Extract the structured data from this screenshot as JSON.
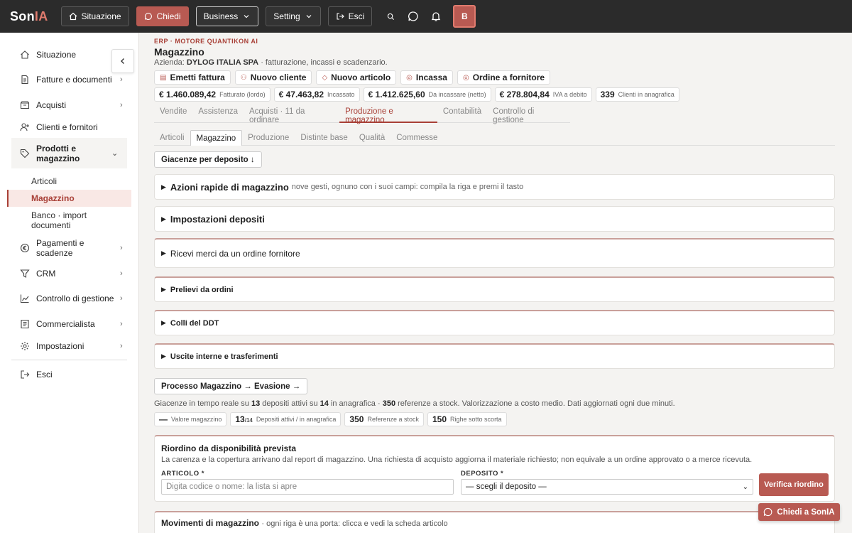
{
  "topbar": {
    "logo_a": "Son",
    "logo_b": "IA",
    "situazione": "Situazione",
    "chiedi": "Chiedi",
    "business": "Business",
    "setting": "Setting",
    "esci": "Esci",
    "avatar": "B"
  },
  "sidebar": {
    "situazione": "Situazione",
    "fatture": "Fatture e documenti",
    "acquisti": "Acquisti",
    "clienti": "Clienti e fornitori",
    "prodotti": "Prodotti e magazzino",
    "articoli": "Articoli",
    "magazzino": "Magazzino",
    "banco": "Banco · import documenti",
    "pagamenti": "Pagamenti e scadenze",
    "crm": "CRM",
    "controllo": "Controllo di gestione",
    "commercialista": "Commercialista",
    "impostazioni": "Impostazioni",
    "esci": "Esci"
  },
  "header": {
    "eyebrow": "ERP · MOTORE QUANTIKON AI",
    "title": "Magazzino",
    "company_label": "Azienda:",
    "company_name": "DYLOG ITALIA SPA",
    "company_desc": "· fatturazione, incassi e scadenzario."
  },
  "actions": {
    "emetti": "Emetti fattura",
    "nuovo_cliente": "Nuovo cliente",
    "nuovo_articolo": "Nuovo articolo",
    "incassa": "Incassa",
    "ordine": "Ordine a fornitore"
  },
  "kpis": [
    {
      "value": "€ 1.460.089,42",
      "label": "Fatturato (lordo)"
    },
    {
      "value": "€ 47.463,82",
      "label": "Incassato"
    },
    {
      "value": "€ 1.412.625,60",
      "label": "Da incassare (netto)"
    },
    {
      "value": "€ 278.804,84",
      "label": "IVA a debito"
    },
    {
      "value": "339",
      "label": "Clienti in anagrafica"
    }
  ],
  "tabs": {
    "vendite": "Vendite",
    "assistenza": "Assistenza",
    "acquisti": "Acquisti · 11 da ordinare",
    "produzione": "Produzione e magazzino",
    "contabilita": "Contabilità",
    "controllo": "Controllo di gestione"
  },
  "subtabs": {
    "articoli": "Articoli",
    "magazzino": "Magazzino",
    "produzione": "Produzione",
    "distinte": "Distinte base",
    "qualita": "Qualità",
    "commesse": "Commesse"
  },
  "giacenze_btn": "Giacenze per deposito ↓",
  "panels": {
    "azioni_title": "Azioni rapide di magazzino",
    "azioni_desc": "nove gesti, ognuno con i suoi campi: compila la riga e premi il tasto",
    "impostazioni": "Impostazioni depositi",
    "ricevi": "Ricevi merci da un ordine fornitore",
    "prelievi": "Prelievi da ordini",
    "colli": "Colli del DDT",
    "uscite": "Uscite interne e trasferimenti"
  },
  "processo_btn": "Processo Magazzino → Evasione →",
  "note": {
    "a": "Giacenze in tempo reale su",
    "n1": "13",
    "b": "depositi attivi su",
    "n2": "14",
    "c": "in anagrafica ·",
    "n3": "350",
    "d": "referenze a stock. Valorizzazione a costo medio. Dati aggiornati ogni due minuti."
  },
  "stats": {
    "valore_v": "—",
    "valore_l": "Valore magazzino",
    "depositi_v": "13",
    "depositi_sub": "/14",
    "depositi_l": "Depositi attivi / in anagrafica",
    "referenze_v": "350",
    "referenze_l": "Referenze a stock",
    "righe_v": "150",
    "righe_l": "Righe sotto scorta"
  },
  "reorder": {
    "title": "Riordino da disponibilità prevista",
    "desc": "La carenza e la copertura arrivano dal report di magazzino. Una richiesta di acquisto aggiorna il materiale richiesto; non equivale a un ordine approvato o a merce ricevuta.",
    "articolo_label": "ARTICOLO *",
    "articolo_placeholder": "Digita codice o nome: la lista si apre",
    "deposito_label": "DEPOSITO *",
    "deposito_value": "— scegli il deposito —",
    "verifica": "Verifica riordino"
  },
  "movements": {
    "title": "Movimenti di magazzino",
    "desc": "· ogni riga è una porta: clicca e vedi la scheda articolo"
  },
  "chat": "Chiedi a SonIA"
}
